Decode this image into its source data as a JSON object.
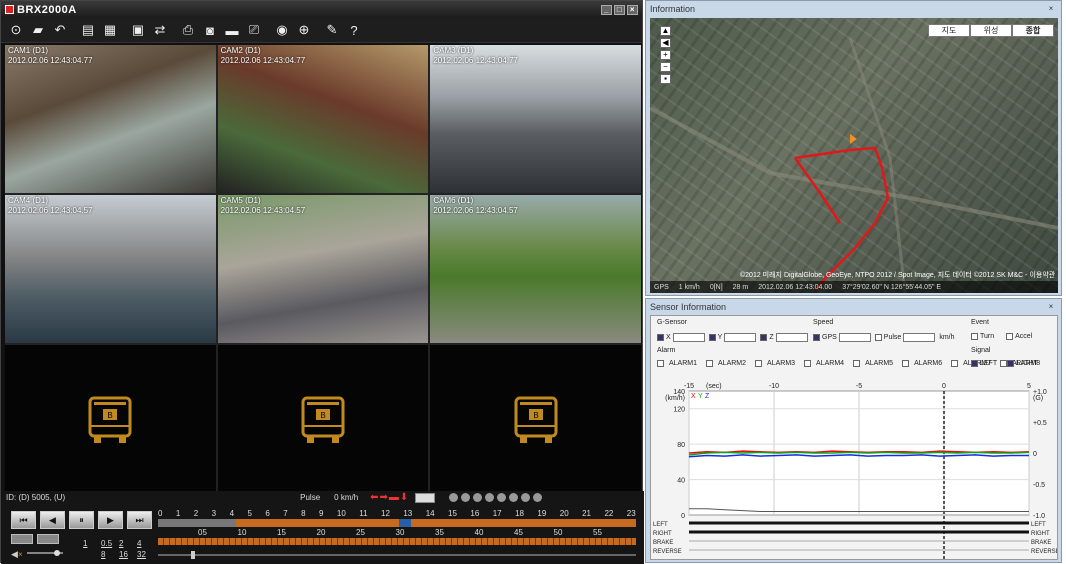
{
  "app": {
    "title": "BRX2000A"
  },
  "toolbar": [
    "open-icon",
    "folder-icon",
    "back-icon",
    "list-icon",
    "grid-icon",
    "export-icon",
    "convert-icon",
    "print-icon",
    "camera-icon",
    "save-icon",
    "printer-icon",
    "record-icon",
    "download-icon",
    "settings-icon",
    "help-icon"
  ],
  "cameras": [
    {
      "name": "CAM1 (D1)",
      "date": "2012.02.06   12:43:04.77"
    },
    {
      "name": "CAM2 (D1)",
      "date": "2012.02.06   12:43:04.77"
    },
    {
      "name": "CAM3 (D1)",
      "date": "2012.02.06   12:43:04.77"
    },
    {
      "name": "CAM4 (D1)",
      "date": "2012.02.06   12:43:04.57"
    },
    {
      "name": "CAM5 (D1)",
      "date": "2012.02.06   12:43:04.57"
    },
    {
      "name": "CAM6 (D1)",
      "date": "2012.02.06   12:43:04.57"
    }
  ],
  "bottom": {
    "id": "ID: (D) 5005, (U)",
    "pulse": "Pulse",
    "speed": "0 km/h"
  },
  "playback": [
    "⏮",
    "◀",
    "⏸",
    "▶",
    "⏭"
  ],
  "speeds": [
    "1",
    "0.5",
    "2",
    "4",
    "8",
    "16",
    "32"
  ],
  "timeline": {
    "hours": [
      "0",
      "1",
      "2",
      "3",
      "4",
      "5",
      "6",
      "7",
      "8",
      "9",
      "10",
      "11",
      "12",
      "13",
      "14",
      "15",
      "16",
      "17",
      "18",
      "19",
      "20",
      "21",
      "22",
      "23"
    ],
    "minutes": [
      "05",
      "10",
      "15",
      "20",
      "25",
      "30",
      "35",
      "40",
      "45",
      "50",
      "55"
    ]
  },
  "info": {
    "title": "Information",
    "maptypes": [
      "지도",
      "위성",
      "종합"
    ],
    "status": [
      "GPS",
      "1 km/h",
      "0[N]",
      "28 m",
      "2012.02.06  12:43:04.00",
      "37°29'02.60\" N  126°55'44.05\" E"
    ],
    "attrib": "©2012 미래지 DigitalGlobe, GeoEye, NTPO 2012 / Spot Image, 지도 데이터 ©2012 SK M&C - 이용약관"
  },
  "sensor": {
    "title": "Sensor Information",
    "gsensor": "G-Sensor",
    "speed": "Speed",
    "event": "Event",
    "alarm": "Alarm",
    "signal": "Signal",
    "axes": [
      "X",
      "Y",
      "Z"
    ],
    "speedfields": [
      "GPS",
      "Pulse"
    ],
    "kmh": "km/h",
    "events": [
      "Turn",
      "Accel"
    ],
    "alarms": [
      "ALARM1",
      "ALARM2",
      "ALARM3",
      "ALARM4",
      "ALARM5",
      "ALARM6",
      "ALARM7",
      "ALARM8"
    ],
    "signals": [
      "LEFT",
      "RIGHT"
    ]
  },
  "chart_data": {
    "type": "line",
    "x_label": "(sec)",
    "x_ticks": [
      "-15",
      "-10",
      "-5",
      "0",
      "5"
    ],
    "y_left_label": "(km/h)",
    "y_left_ticks": [
      "140",
      "120",
      "80",
      "40",
      "0"
    ],
    "y_right_label": "(G)",
    "y_right_ticks": [
      "+1.0",
      "+0.5",
      "0",
      "-0.5",
      "-1.0"
    ],
    "legend": [
      "X",
      "Y",
      "Z"
    ],
    "series_colors": {
      "X": "#e01010",
      "Y": "#18a018",
      "Z": "#1030e0"
    },
    "series": [
      {
        "name": "X",
        "values": [
          0.0,
          0.02,
          0.01,
          0.03,
          0.02,
          0.01,
          0.02,
          0.01,
          0.03,
          0.02,
          0.01,
          0.02,
          0.02,
          0.01,
          0.03,
          0.02,
          0.01,
          0.02,
          0.01,
          0.02
        ]
      },
      {
        "name": "Y",
        "values": [
          -0.03,
          0.0,
          0.01,
          0.0,
          0.01,
          0.0,
          0.01,
          0.0,
          0.0,
          0.01,
          0.0,
          0.01,
          0.0,
          0.0,
          0.01,
          0.0,
          0.01,
          0.0,
          0.0,
          0.01
        ]
      },
      {
        "name": "Z",
        "values": [
          -0.06,
          -0.04,
          -0.05,
          -0.03,
          -0.05,
          -0.04,
          -0.03,
          -0.05,
          -0.04,
          -0.03,
          -0.05,
          -0.04,
          -0.04,
          -0.03,
          -0.05,
          -0.04,
          -0.03,
          -0.05,
          -0.04,
          -0.04
        ]
      }
    ],
    "speed_kmh": [
      7,
      7,
      6,
      5,
      4,
      4,
      4,
      4,
      4,
      4,
      4,
      4,
      4,
      4,
      4,
      4,
      4,
      4,
      4,
      4
    ],
    "signal_rows": [
      "LEFT",
      "RIGHT",
      "BRAKE",
      "REVERSE"
    ]
  }
}
